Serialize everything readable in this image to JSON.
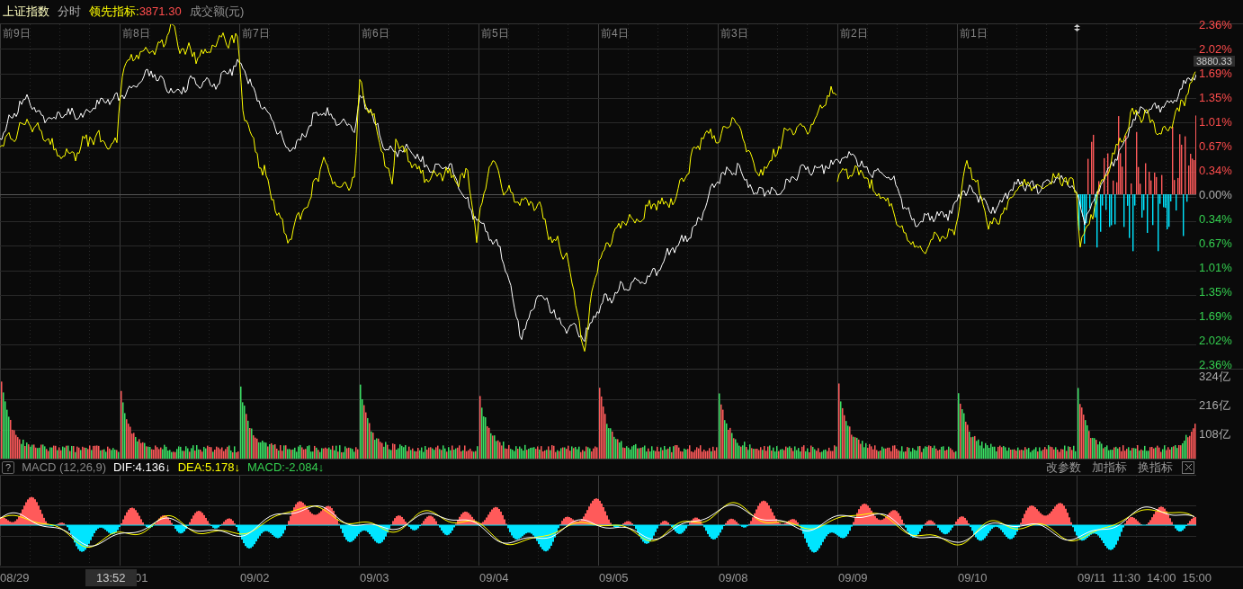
{
  "header": {
    "index_name": "上证指数",
    "period": "分时",
    "leading_label": "领先指标:",
    "leading_value": "3871.30",
    "volume_label": "成交额(元)"
  },
  "day_labels": [
    "前9日",
    "前8日",
    "前7日",
    "前6日",
    "前5日",
    "前4日",
    "前3日",
    "前2日",
    "前1日"
  ],
  "price_axis": [
    {
      "label": "2.36%",
      "kind": "up"
    },
    {
      "label": "2.02%",
      "kind": "up"
    },
    {
      "label": "1.69%",
      "kind": "up"
    },
    {
      "label": "1.35%",
      "kind": "up"
    },
    {
      "label": "1.01%",
      "kind": "up"
    },
    {
      "label": "0.67%",
      "kind": "up"
    },
    {
      "label": "0.34%",
      "kind": "up"
    },
    {
      "label": "0.00%",
      "kind": "flat"
    },
    {
      "label": "0.34%",
      "kind": "down"
    },
    {
      "label": "0.67%",
      "kind": "down"
    },
    {
      "label": "1.01%",
      "kind": "down"
    },
    {
      "label": "1.35%",
      "kind": "down"
    },
    {
      "label": "1.69%",
      "kind": "down"
    },
    {
      "label": "2.02%",
      "kind": "down"
    },
    {
      "label": "2.36%",
      "kind": "down"
    }
  ],
  "price_tag": "3880.33",
  "volume_axis": [
    "324亿",
    "216亿",
    "108亿"
  ],
  "macd_header": {
    "help": "?",
    "name": "MACD (12,26,9)",
    "dif": "DIF:4.136↓",
    "dea": "DEA:5.178↓",
    "macd": "MACD:-2.084↓"
  },
  "macd_buttons": [
    "改参数",
    "加指标",
    "换指标"
  ],
  "time_axis": [
    {
      "label": "08/29"
    },
    {
      "label": "01"
    },
    {
      "label": "09/02"
    },
    {
      "label": "09/03"
    },
    {
      "label": "09/04"
    },
    {
      "label": "09/05"
    },
    {
      "label": "09/08"
    },
    {
      "label": "09/09"
    },
    {
      "label": "09/10"
    },
    {
      "label": "09/11",
      "extra": [
        "11:30",
        "14:00",
        "15:00"
      ]
    }
  ],
  "cursor_time": "13:52"
}
